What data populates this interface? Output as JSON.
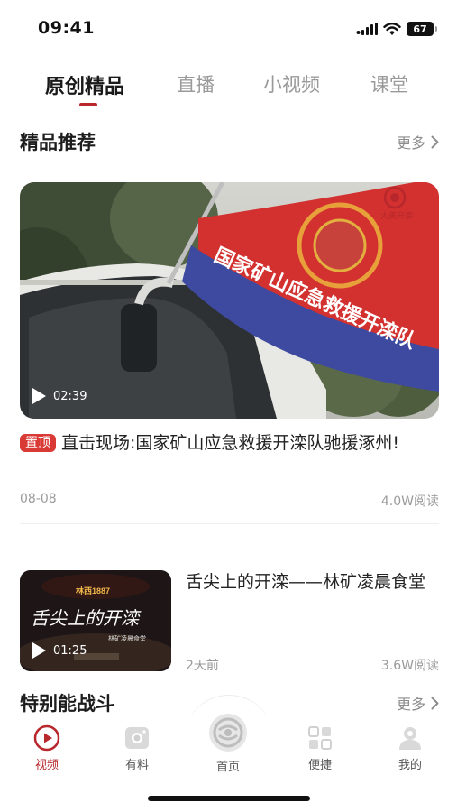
{
  "status_bar": {
    "time": "09:41",
    "battery": "67"
  },
  "top_tabs": [
    {
      "label": "原创精品",
      "active": true
    },
    {
      "label": "直播",
      "active": false
    },
    {
      "label": "小视频",
      "active": false
    },
    {
      "label": "课堂",
      "active": false
    }
  ],
  "sections": {
    "featured": {
      "title": "精品推荐",
      "more": "更多"
    },
    "special": {
      "title": "特别能战斗",
      "more": "更多"
    }
  },
  "featured_video": {
    "duration": "02:39",
    "badge": "置顶",
    "title": "直击现场:国家矿山应急救援开滦队驰援涿州!",
    "date": "08-08",
    "reads": "4.0W阅读",
    "flag_text": "国家矿山应急救援开滦队",
    "watermark": "大美开滦"
  },
  "list_item": {
    "duration": "01:25",
    "title": "舌尖上的开滦——林矿凌晨食堂",
    "time": "2天前",
    "reads": "3.6W阅读",
    "thumb_sign": "林西1887",
    "thumb_script": "舌尖上的开滦",
    "thumb_caption": "林矿凌晨食堂"
  },
  "bottom_nav": [
    {
      "label": "视频",
      "icon": "video-play-icon",
      "active": true
    },
    {
      "label": "有料",
      "icon": "camera-icon",
      "active": false
    },
    {
      "label": "首页",
      "icon": "home-logo-icon",
      "active": false
    },
    {
      "label": "便捷",
      "icon": "grid-apps-icon",
      "active": false
    },
    {
      "label": "我的",
      "icon": "user-icon",
      "active": false
    }
  ],
  "colors": {
    "accent": "#b8272c",
    "badge": "#d93a35",
    "flag_red": "#d2312f",
    "flag_blue": "#3e4aa0"
  }
}
